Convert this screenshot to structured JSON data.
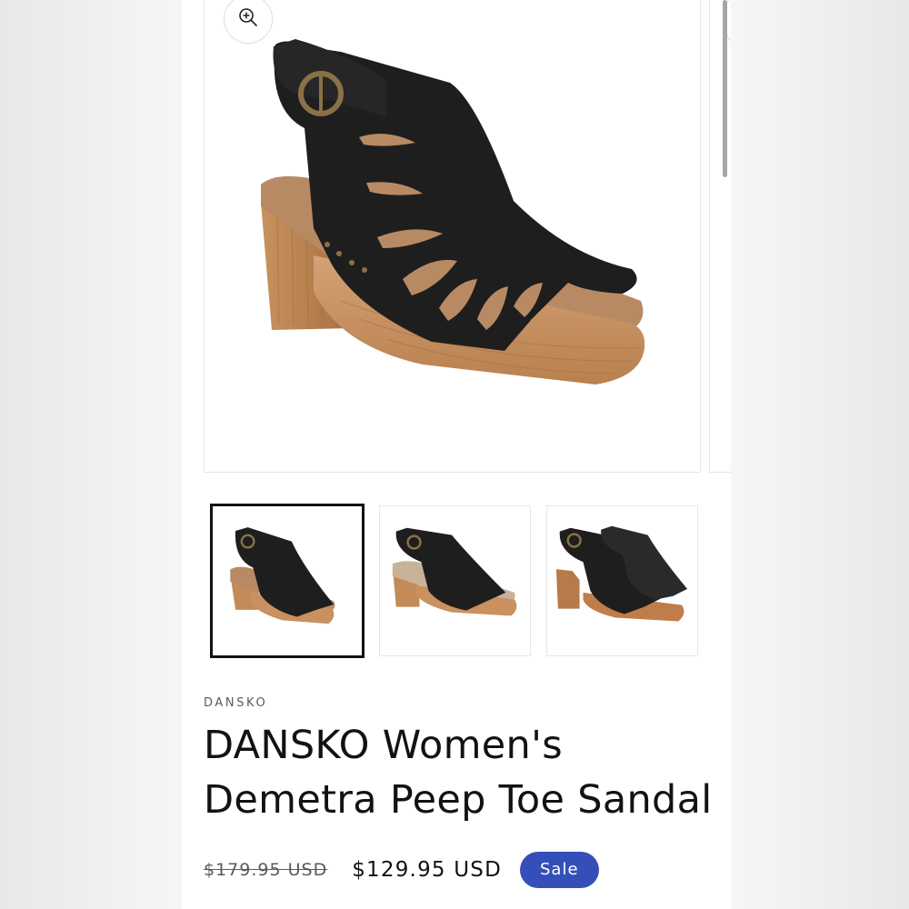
{
  "product": {
    "vendor": "DANSKO",
    "title_line1": "DANSKO Women's",
    "title_line2": "Demetra Peep Toe Sandal",
    "price_compare": "$179.95 USD",
    "price_sale": "$129.95 USD",
    "badge": "Sale"
  },
  "gallery": {
    "zoom_icon": "zoom-in-icon",
    "thumbnails": [
      {
        "name": "thumbnail-1",
        "selected": true
      },
      {
        "name": "thumbnail-2",
        "selected": false
      },
      {
        "name": "thumbnail-3",
        "selected": false
      }
    ]
  },
  "colors": {
    "badge": "#3450b8",
    "text": "#121212",
    "leather": "#1e1e1e",
    "wood": "#c8915f",
    "footbed": "#b88a64"
  }
}
